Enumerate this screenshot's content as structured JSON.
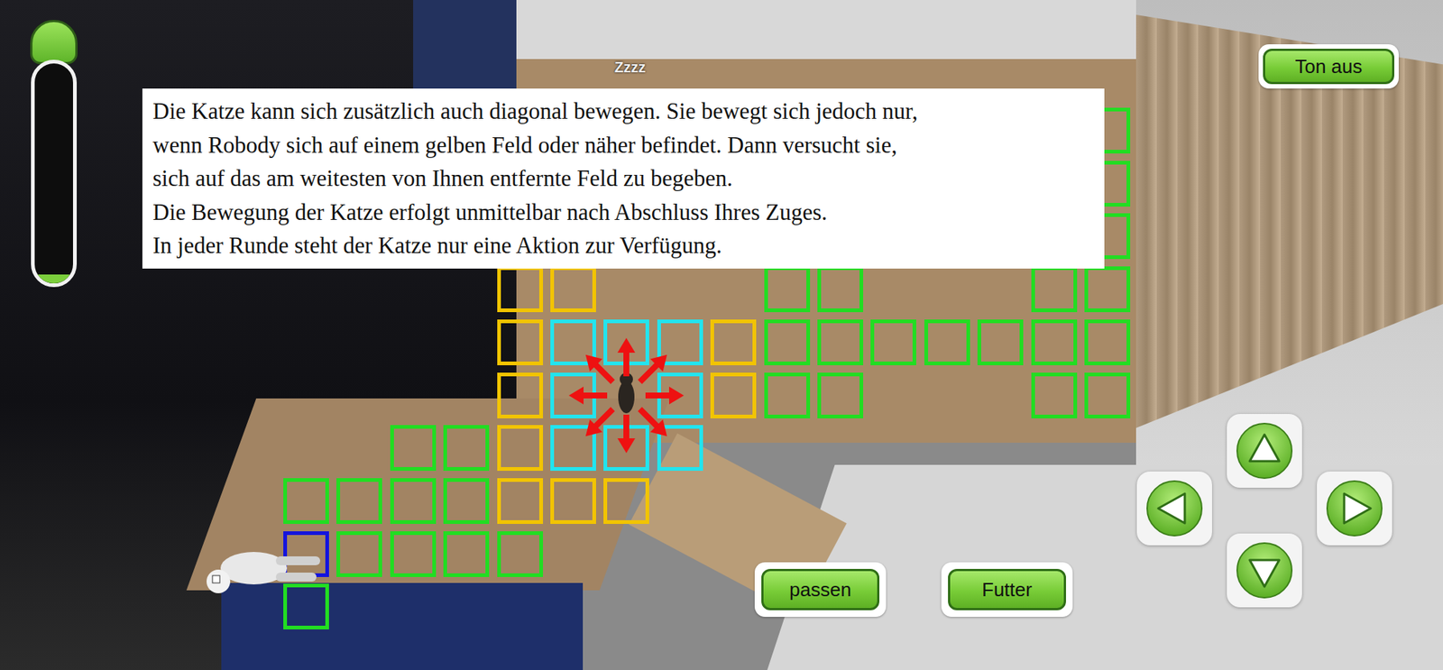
{
  "hud": {
    "meter": {
      "level": 0.04
    },
    "sound_button": "Ton aus"
  },
  "sleep_label": "Zzzz",
  "dialog": {
    "lines": [
      "Die Katze kann sich zusätzlich auch diagonal bewegen. Sie bewegt sich jedoch nur,",
      "wenn Robody sich auf einem gelben Feld oder näher befindet. Dann versucht sie,",
      "sich auf das am weitesten von Ihnen entfernte Feld zu begeben.",
      "Die Bewegung der Katze erfolgt unmittelbar nach Abschluss Ihres Zuges.",
      "In jeder Runde steht der Katze nur eine Aktion zur Verfügung."
    ]
  },
  "board": {
    "cells": [
      {
        "col": 0,
        "row": 9,
        "color": "#22dd22"
      },
      {
        "col": 0,
        "row": 8,
        "color": "#1414dd"
      },
      {
        "col": 1,
        "row": 8,
        "color": "#22dd22"
      },
      {
        "col": 2,
        "row": 8,
        "color": "#22dd22"
      },
      {
        "col": 3,
        "row": 8,
        "color": "#22dd22"
      },
      {
        "col": 4,
        "row": 8,
        "color": "#22dd22"
      },
      {
        "col": 0,
        "row": 7,
        "color": "#22dd22"
      },
      {
        "col": 1,
        "row": 7,
        "color": "#22dd22"
      },
      {
        "col": 2,
        "row": 7,
        "color": "#22dd22"
      },
      {
        "col": 3,
        "row": 7,
        "color": "#22dd22"
      },
      {
        "col": 4,
        "row": 7,
        "color": "#f2c400"
      },
      {
        "col": 5,
        "row": 7,
        "color": "#f2c400"
      },
      {
        "col": 6,
        "row": 7,
        "color": "#f2c400"
      },
      {
        "col": 2,
        "row": 6,
        "color": "#22dd22"
      },
      {
        "col": 3,
        "row": 6,
        "color": "#22dd22"
      },
      {
        "col": 4,
        "row": 6,
        "color": "#f2c400"
      },
      {
        "col": 5,
        "row": 6,
        "color": "#22e4ee"
      },
      {
        "col": 6,
        "row": 6,
        "color": "#22e4ee"
      },
      {
        "col": 7,
        "row": 6,
        "color": "#22e4ee"
      },
      {
        "col": 4,
        "row": 5,
        "color": "#f2c400"
      },
      {
        "col": 5,
        "row": 5,
        "color": "#22e4ee"
      },
      {
        "col": 7,
        "row": 5,
        "color": "#22e4ee"
      },
      {
        "col": 8,
        "row": 5,
        "color": "#f2c400"
      },
      {
        "col": 9,
        "row": 5,
        "color": "#22dd22"
      },
      {
        "col": 10,
        "row": 5,
        "color": "#22dd22"
      },
      {
        "col": 14,
        "row": 5,
        "color": "#22dd22"
      },
      {
        "col": 15,
        "row": 5,
        "color": "#22dd22"
      },
      {
        "col": 4,
        "row": 4,
        "color": "#f2c400"
      },
      {
        "col": 5,
        "row": 4,
        "color": "#22e4ee"
      },
      {
        "col": 6,
        "row": 4,
        "color": "#22e4ee"
      },
      {
        "col": 7,
        "row": 4,
        "color": "#22e4ee"
      },
      {
        "col": 8,
        "row": 4,
        "color": "#f2c400"
      },
      {
        "col": 9,
        "row": 4,
        "color": "#22dd22"
      },
      {
        "col": 10,
        "row": 4,
        "color": "#22dd22"
      },
      {
        "col": 11,
        "row": 4,
        "color": "#22dd22"
      },
      {
        "col": 12,
        "row": 4,
        "color": "#22dd22"
      },
      {
        "col": 13,
        "row": 4,
        "color": "#22dd22"
      },
      {
        "col": 14,
        "row": 4,
        "color": "#22dd22"
      },
      {
        "col": 15,
        "row": 4,
        "color": "#22dd22"
      },
      {
        "col": 4,
        "row": 3,
        "color": "#f2c400"
      },
      {
        "col": 5,
        "row": 3,
        "color": "#f2c400"
      },
      {
        "col": 9,
        "row": 3,
        "color": "#22dd22"
      },
      {
        "col": 10,
        "row": 3,
        "color": "#22dd22"
      },
      {
        "col": 14,
        "row": 3,
        "color": "#22dd22"
      },
      {
        "col": 15,
        "row": 3,
        "color": "#22dd22"
      },
      {
        "col": 15,
        "row": 2,
        "color": "#22dd22"
      },
      {
        "col": 15,
        "row": 1,
        "color": "#22dd22"
      },
      {
        "col": 15,
        "row": 0,
        "color": "#22dd22"
      }
    ],
    "cat": {
      "col": 6,
      "row": 5
    },
    "robody": {
      "col": 0,
      "row": 8
    }
  },
  "actions": [
    "passen",
    "Futter"
  ],
  "dpad": [
    {
      "direction": "up"
    },
    {
      "direction": "left"
    },
    {
      "direction": "right"
    },
    {
      "direction": "down"
    }
  ]
}
